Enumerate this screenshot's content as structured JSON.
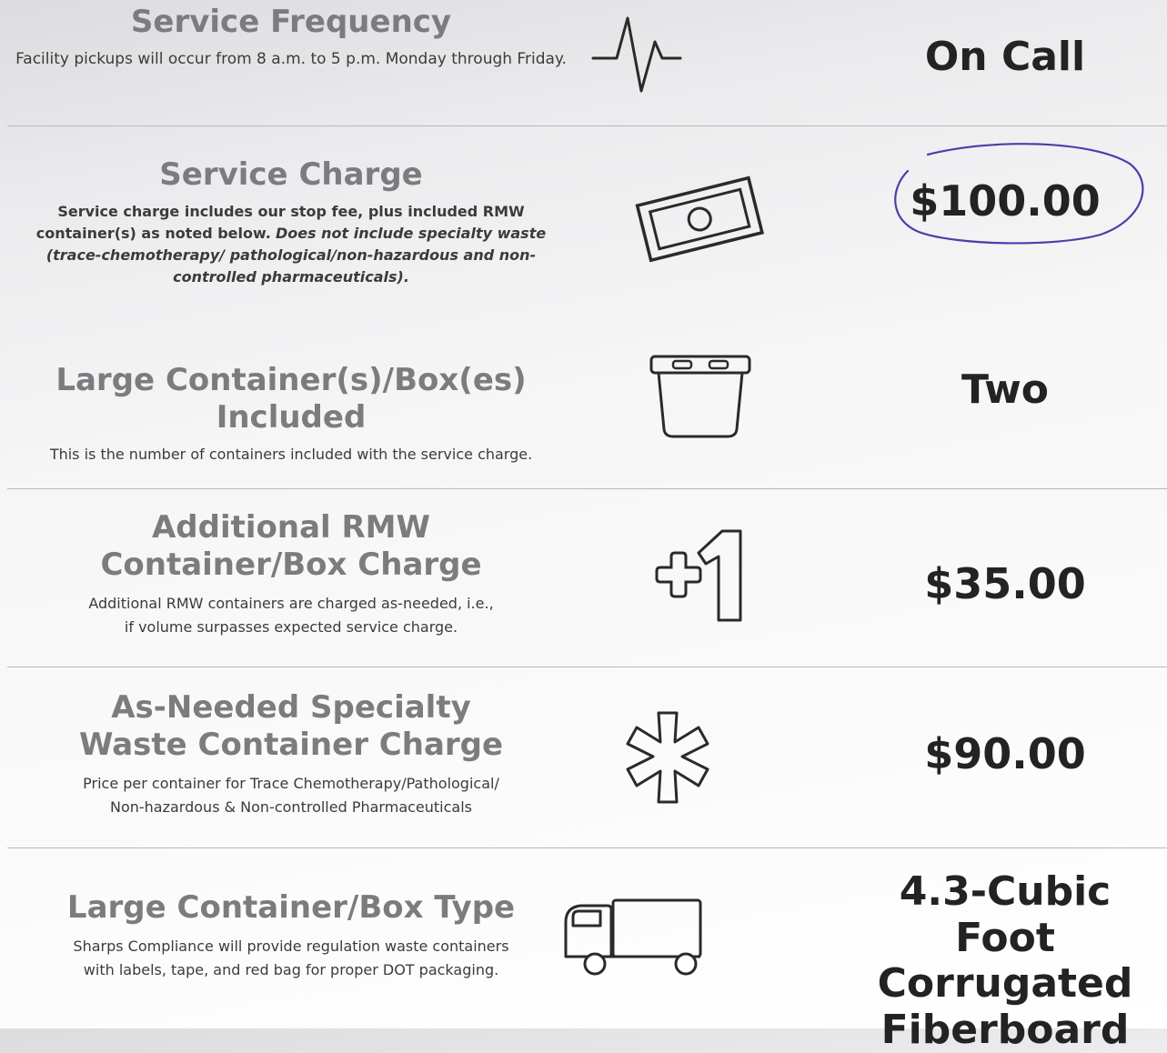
{
  "rows": [
    {
      "title": "Service Frequency",
      "desc": "Facility pickups will occur from 8 a.m. to 5 p.m. Monday through Friday.",
      "icon": "heartbeat-pulse-icon",
      "value": "On Call"
    },
    {
      "title": "Service Charge",
      "desc_bold": "Service charge includes our stop fee, plus included RMW container(s) as noted below.",
      "desc_italic": "Does not include specialty waste (trace-chemotherapy/ pathological/non-hazardous and non-controlled pharmaceuticals).",
      "icon": "money-bill-icon",
      "value": "$100.00",
      "annotation": "hand-drawn-circle"
    },
    {
      "title": "Large Container(s)/Box(es) Included",
      "desc": "This is the number of containers included with the service charge.",
      "icon": "container-tub-icon",
      "value": "Two"
    },
    {
      "title_line1": "Additional RMW",
      "title_line2": "Container/Box Charge",
      "desc_line1": "Additional RMW containers are charged as-needed, i.e.,",
      "desc_line2": "if volume surpasses expected service charge.",
      "icon": "plus-one-icon",
      "value": "$35.00"
    },
    {
      "title_line1": "As-Needed Specialty",
      "title_line2": "Waste Container Charge",
      "desc_line1": "Price per container for Trace Chemotherapy/Pathological/",
      "desc_line2": "Non-hazardous & Non-controlled Pharmaceuticals",
      "icon": "asterisk-icon",
      "value": "$90.00"
    },
    {
      "title": "Large Container/Box Type",
      "desc_line1": "Sharps Compliance will provide regulation waste containers",
      "desc_line2": "with labels, tape, and red bag for proper DOT packaging.",
      "icon": "delivery-truck-icon",
      "value_line1": "4.3-Cubic Foot",
      "value_line2": "Corrugated",
      "value_line3": "Fiberboard"
    }
  ],
  "colors": {
    "title": "#7c7c7e",
    "value": "#232323",
    "ink": "#4a3fa8"
  }
}
